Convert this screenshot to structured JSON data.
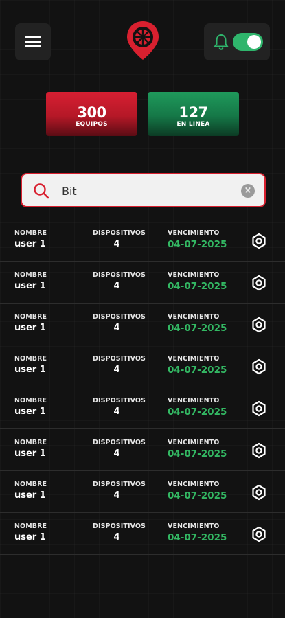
{
  "header": {
    "menu_icon": "menu-icon",
    "logo_icon": "location-pin-logo",
    "bell_icon": "bell-icon",
    "notifications_enabled": true,
    "accent_red": "#d8202f",
    "accent_green": "#2fb56c"
  },
  "stats": {
    "equipos": {
      "value": "300",
      "label": "EQUIPOS"
    },
    "en_linea": {
      "value": "127",
      "label": "EN LINEA"
    }
  },
  "search": {
    "value": "Bit",
    "icon": "search-icon",
    "clear_icon": "clear-icon"
  },
  "columns": {
    "name": "NOMBRE",
    "devices": "DISPOSITIVOS",
    "expiry": "VENCIMIENTO"
  },
  "rows": [
    {
      "name": "user 1",
      "devices": "4",
      "expiry": "04-07-2025"
    },
    {
      "name": "user 1",
      "devices": "4",
      "expiry": "04-07-2025"
    },
    {
      "name": "user 1",
      "devices": "4",
      "expiry": "04-07-2025"
    },
    {
      "name": "user 1",
      "devices": "4",
      "expiry": "04-07-2025"
    },
    {
      "name": "user 1",
      "devices": "4",
      "expiry": "04-07-2025"
    },
    {
      "name": "user 1",
      "devices": "4",
      "expiry": "04-07-2025"
    },
    {
      "name": "user 1",
      "devices": "4",
      "expiry": "04-07-2025"
    },
    {
      "name": "user 1",
      "devices": "4",
      "expiry": "04-07-2025"
    }
  ]
}
